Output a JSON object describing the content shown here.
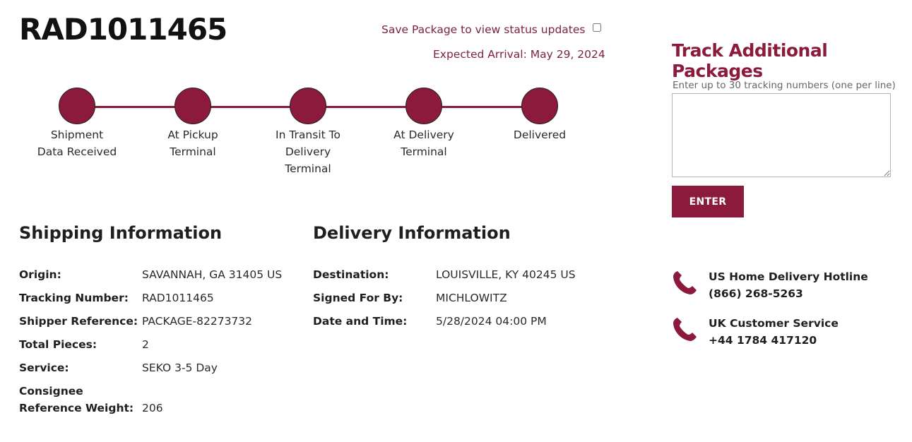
{
  "tracking_number": "RAD1011465",
  "save_package_label": "Save Package to view status updates",
  "expected_arrival": "Expected Arrival: May 29, 2024",
  "timeline": {
    "steps": [
      {
        "label": "Shipment\nData Received"
      },
      {
        "label": "At Pickup\nTerminal"
      },
      {
        "label": "In Transit To\nDelivery\nTerminal"
      },
      {
        "label": "At Delivery\nTerminal"
      },
      {
        "label": "Delivered"
      }
    ]
  },
  "shipping": {
    "title": "Shipping Information",
    "rows": [
      {
        "label": "Origin:",
        "value": "SAVANNAH, GA 31405 US"
      },
      {
        "label": "Tracking Number:",
        "value": "RAD1011465"
      },
      {
        "label": "Shipper Reference:",
        "value": "PACKAGE-82273732"
      },
      {
        "label": "Total Pieces:",
        "value": "2"
      },
      {
        "label": "Service:",
        "value": "SEKO 3-5 Day"
      },
      {
        "label": "Consignee\nReference Weight:",
        "value": "206"
      }
    ]
  },
  "delivery": {
    "title": "Delivery Information",
    "rows": [
      {
        "label": "Destination:",
        "value": "LOUISVILLE, KY 40245 US"
      },
      {
        "label": "Signed For By:",
        "value": "MICHLOWITZ"
      },
      {
        "label": "Date and Time:",
        "value": "5/28/2024 04:00 PM"
      }
    ]
  },
  "track_additional": {
    "title": "Track Additional Packages",
    "hint": "Enter up to 30 tracking numbers (one per line)",
    "textarea_value": "",
    "button_label": "ENTER"
  },
  "contacts": [
    {
      "name": "US Home Delivery Hotline",
      "phone": "(866) 268-5263"
    },
    {
      "name": "UK Customer Service",
      "phone": "+44 1784 417120"
    }
  ],
  "colors": {
    "accent": "#8b1a3d",
    "muted_accent": "#7d2340"
  }
}
